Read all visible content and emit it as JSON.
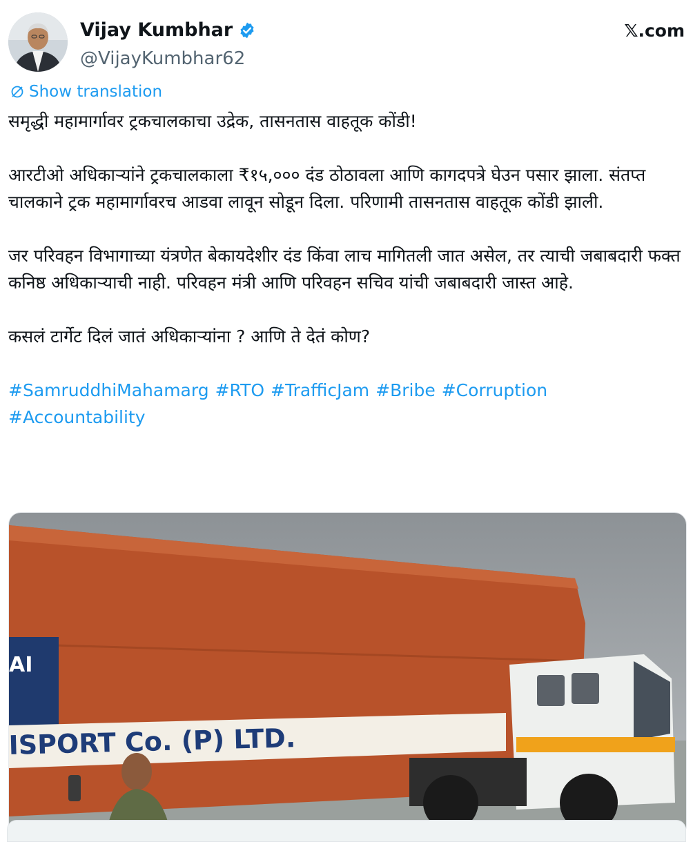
{
  "author": {
    "name": "Vijay Kumbhar",
    "handle": "@VijayKumbhar62",
    "verified": true,
    "avatar_icon": "person-portrait-icon"
  },
  "brand": {
    "label": "𝕏.com"
  },
  "translate": {
    "label": "Show translation",
    "icon": "translate-icon"
  },
  "tweet": {
    "headline": "समृद्धी महामार्गावर ट्रकचालकाचा उद्रेक, तासनतास वाहतूक कोंडी!",
    "para1": "आरटीओ अधिकाऱ्यांने ट्रकचालकाला ₹१५,००० दंड ठोठावला आणि कागदपत्रे घेउन पसार झाला. संतप्त चालकाने ट्रक महामार्गावरच आडवा लावून सोडून दिला. परिणामी तासनतास वाहतूक कोंडी झाली.",
    "para2": "जर परिवहन विभागाच्या यंत्रणेत बेकायदेशीर दंड किंवा लाच मागितली जात असेल, तर त्याची जबाबदारी फक्त कनिष्ठ अधिकाऱ्याची नाही. परिवहन मंत्री आणि परिवहन सचिव यांची जबाबदारी जास्त आहे.",
    "para3": "कसलं टार्गेट दिलं जातं अधिकाऱ्यांना ? आणि ते देतं कोण?",
    "hashtags": [
      "#SamruddhiMahamarg",
      "#RTO",
      "#TrafficJam",
      "#Bribe",
      "#Corruption",
      "#Accountability"
    ]
  },
  "media": {
    "truck_lettering": "ISPORT Co. (P) LTD.",
    "side_lettering": "AI"
  },
  "colors": {
    "link": "#1d9bf0",
    "verified": "#1d9bf0",
    "text": "#0f1419",
    "secondary": "#536471"
  }
}
